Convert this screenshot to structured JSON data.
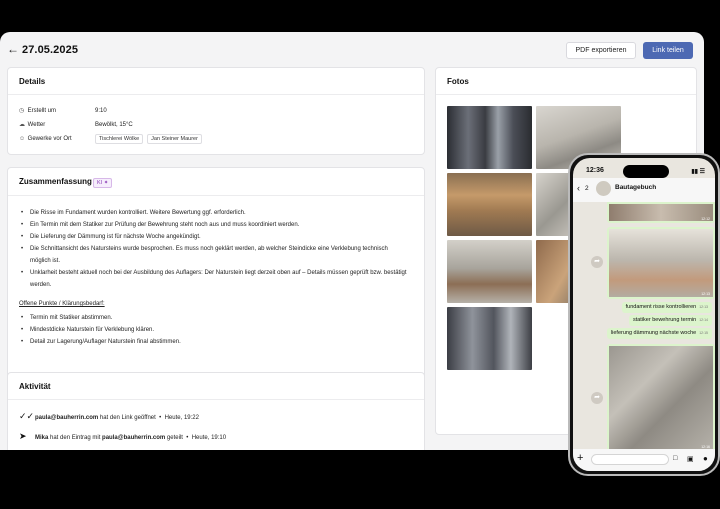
{
  "header": {
    "back_icon": "arrow-left-icon",
    "date": "27.05.2025",
    "pdf_label": "PDF exportieren",
    "share_label": "Link teilen"
  },
  "details": {
    "title": "Details",
    "rows": [
      {
        "icon": "clock-icon",
        "label": "Erstellt um",
        "value": "9:10"
      },
      {
        "icon": "cloud-icon",
        "label": "Wetter",
        "value": "Bewölkt, 15°C"
      },
      {
        "icon": "people-icon",
        "label": "Gewerke vor Ort",
        "tags": [
          "Tischlerei Wölke",
          "Jan Steiner Maurer"
        ]
      }
    ]
  },
  "summary": {
    "title": "Zusammenfassung",
    "badge": "KI",
    "bullets": [
      "Die Risse im Fundament wurden kontrolliert. Weitere Bewertung ggf. erforderlich.",
      "Ein Termin mit dem Statiker zur Prüfung der Bewehrung steht noch aus und muss koordiniert werden.",
      "Die Lieferung der Dämmung ist für nächste Woche angekündigt.",
      "Die Schnittansicht des Natursteins wurde besprochen. Es muss noch geklärt werden, ab welcher Steindicke eine Verklebung technisch möglich ist.",
      "Unklarheit besteht aktuell noch bei der Ausbildung des Auflagers: Der Naturstein liegt derzeit oben auf – Details müssen geprüft bzw. bestätigt werden."
    ],
    "open_title": "Offene Punkte / Klärungsbedarf:",
    "open_items": [
      "Termin mit Statiker abstimmen.",
      "Mindestdicke Naturstein für Verklebung klären.",
      "Detail zur Lagerung/Auflager Naturstein final abstimmen."
    ]
  },
  "activity": {
    "title": "Aktivität",
    "items": [
      {
        "icon": "double-check-icon",
        "user": "paula@bauherrin.com",
        "text": " hat den Link geöffnet",
        "time": "Heute, 19:22"
      },
      {
        "icon": "paper-plane-icon",
        "user": "Mika",
        "text": " hat den Eintrag mit ",
        "target": "paula@bauherrin.com",
        "text2": " geteilt",
        "time": "Heute, 19:10"
      }
    ]
  },
  "photos": {
    "title": "Fotos"
  },
  "phone": {
    "time": "12:36",
    "back_count": "2",
    "chat_name": "Bautagebuch",
    "messages": [
      {
        "text": "fundament risse kontrollieren",
        "time": "12:13"
      },
      {
        "text": "statiker bewehrung termin",
        "time": "12:14"
      },
      {
        "text": "lieferung dämmung nächste woche",
        "time": "12:15"
      }
    ],
    "img_times": [
      "12:12",
      "12:13",
      "12:16"
    ]
  }
}
